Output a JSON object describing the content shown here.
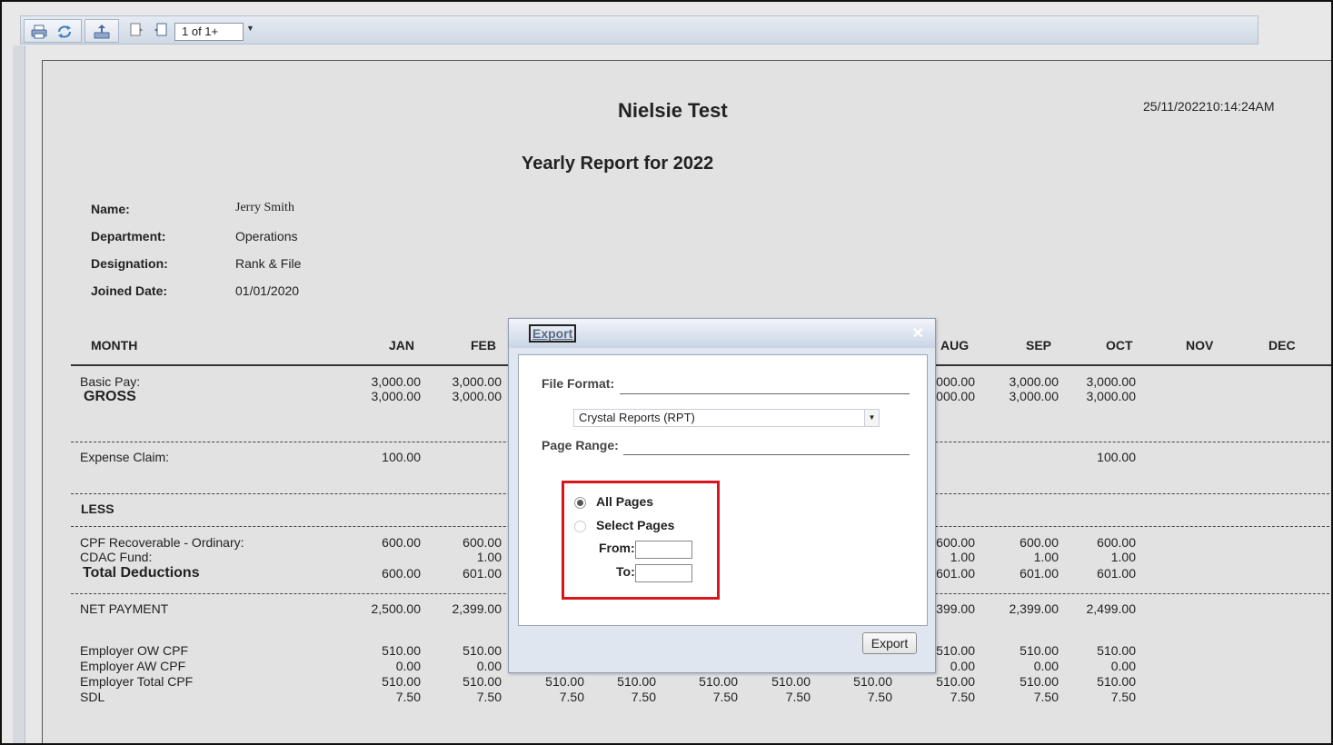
{
  "toolbar": {
    "icons": [
      "print-icon",
      "refresh-icon",
      "export-icon",
      "page-icon",
      "page-search-icon"
    ],
    "page_indicator": "1 of 1+"
  },
  "report": {
    "company": "Nielsie Test",
    "timestamp": "25/11/202210:14:24AM",
    "title": "Yearly Report for",
    "year": "2022",
    "info": [
      {
        "label": "Name:",
        "value": "Jerry Smith"
      },
      {
        "label": "Department:",
        "value": "Operations"
      },
      {
        "label": "Designation:",
        "value": "Rank & File"
      },
      {
        "label": "Joined Date:",
        "value": "01/01/2020"
      }
    ],
    "month_label": "MONTH",
    "months": [
      "JAN",
      "FEB",
      "AUG",
      "SEP",
      "OCT",
      "NOV",
      "DEC"
    ],
    "rows": {
      "basic_pay": {
        "label": "Basic Pay:",
        "jan": "3,000.00",
        "feb": "3,000.00",
        "aug": "000.00",
        "sep": "3,000.00",
        "oct": "3,000.00"
      },
      "gross": {
        "label": "GROSS",
        "jan": "3,000.00",
        "feb": "3,000.00",
        "aug": "000.00",
        "sep": "3,000.00",
        "oct": "3,000.00"
      },
      "expense_claim": {
        "label": "Expense Claim:",
        "jan": "100.00",
        "oct": "100.00"
      },
      "less": {
        "label": "LESS"
      },
      "cpf_recoverable": {
        "label": "CPF Recoverable - Ordinary:",
        "jan": "600.00",
        "feb": "600.00",
        "aug": "600.00",
        "sep": "600.00",
        "oct": "600.00"
      },
      "cdac_fund": {
        "label": "CDAC Fund:",
        "feb": "1.00",
        "aug": "1.00",
        "sep": "1.00",
        "oct": "1.00"
      },
      "total_deductions": {
        "label": "Total Deductions",
        "jan": "600.00",
        "feb": "601.00",
        "aug": "601.00",
        "sep": "601.00",
        "oct": "601.00"
      },
      "net_payment": {
        "label": "NET PAYMENT",
        "jan": "2,500.00",
        "feb": "2,399.00",
        "aug": "399.00",
        "sep": "2,399.00",
        "oct": "2,499.00"
      },
      "employer_ow_cpf": {
        "label": "Employer OW CPF",
        "jan": "510.00",
        "feb": "510.00",
        "aug": "510.00",
        "sep": "510.00",
        "oct": "510.00"
      },
      "employer_aw_cpf": {
        "label": "Employer AW CPF",
        "jan": "0.00",
        "feb": "0.00",
        "aug": "0.00",
        "sep": "0.00",
        "oct": "0.00"
      },
      "employer_total_cpf": {
        "label": "Employer Total CPF",
        "values": [
          "510.00",
          "510.00",
          "510.00",
          "510.00",
          "510.00",
          "510.00",
          "510.00",
          "510.00",
          "510.00",
          "510.00"
        ]
      },
      "sdl": {
        "label": "SDL",
        "values": [
          "7.50",
          "7.50",
          "7.50",
          "7.50",
          "7.50",
          "7.50",
          "7.50",
          "7.50",
          "7.50",
          "7.50"
        ]
      }
    }
  },
  "dialog": {
    "title": "Export",
    "close": "✕",
    "file_format_label": "File Format:",
    "file_format_value": "Crystal Reports (RPT)",
    "page_range_label": "Page Range:",
    "option_all": "All Pages",
    "option_select": "Select Pages",
    "from_label": "From:",
    "to_label": "To:",
    "export_button": "Export"
  },
  "colors": {
    "highlight": "#d9161b"
  }
}
